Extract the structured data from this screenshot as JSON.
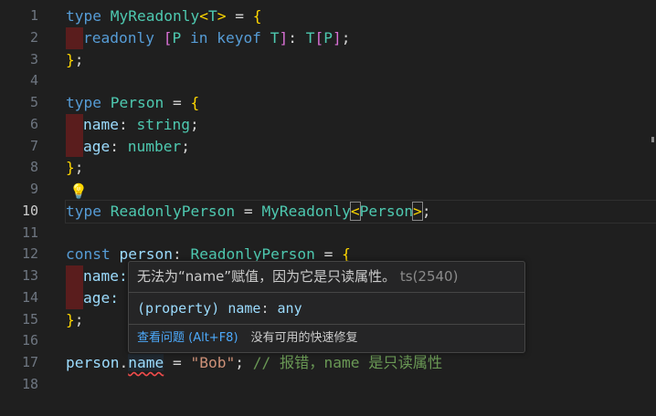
{
  "line_numbers": [
    "1",
    "2",
    "3",
    "4",
    "5",
    "6",
    "7",
    "8",
    "9",
    "10",
    "11",
    "12",
    "13",
    "14",
    "15",
    "16",
    "17",
    "18"
  ],
  "active_line": "10",
  "code": {
    "l1": [
      "type",
      " ",
      "MyReadonly",
      "<",
      "T",
      ">",
      " = ",
      "{"
    ],
    "l2": [
      "readonly",
      " ",
      "[",
      "P",
      " in ",
      "keyof",
      " ",
      "T",
      "]",
      ": ",
      "T",
      "[",
      "P",
      "]",
      ";"
    ],
    "l3": [
      "}",
      ";"
    ],
    "l5": [
      "type",
      " ",
      "Person",
      " = ",
      "{"
    ],
    "l6": [
      "name",
      ": ",
      "string",
      ";"
    ],
    "l7": [
      "age",
      ": ",
      "number",
      ";"
    ],
    "l8": [
      "}",
      ";"
    ],
    "l10": [
      "type",
      " ",
      "ReadonlyPerson",
      " = ",
      "MyReadonly",
      "<",
      "Person",
      ">",
      ";"
    ],
    "l12": [
      "const",
      " ",
      "person",
      ": ",
      "ReadonlyPerson",
      " = ",
      "{"
    ],
    "l13": [
      "name:"
    ],
    "l14": [
      "age:"
    ],
    "l15": [
      "}",
      ";"
    ],
    "l17": [
      "person",
      ".",
      "name",
      " = ",
      "\"Bob\"",
      "; ",
      "// 报错，name 是只读属性"
    ]
  },
  "icons": {
    "lightbulb": "lightbulb-icon"
  },
  "tooltip": {
    "message": "无法为“name”赋值，因为它是只读属性。",
    "code": "ts(2540)",
    "signature_open": "(property) ",
    "signature_name": "name",
    "signature_sep": ": ",
    "signature_type": "any",
    "view_problem": "查看问题 (Alt+F8)",
    "no_fix": "没有可用的快速修复"
  },
  "colors": {
    "keyword": "#569cd6",
    "type": "#4ec9b0",
    "property": "#9cdcfe",
    "string": "#ce9178",
    "comment": "#6a9955",
    "error": "#f14c4c",
    "link": "#4daafc"
  }
}
